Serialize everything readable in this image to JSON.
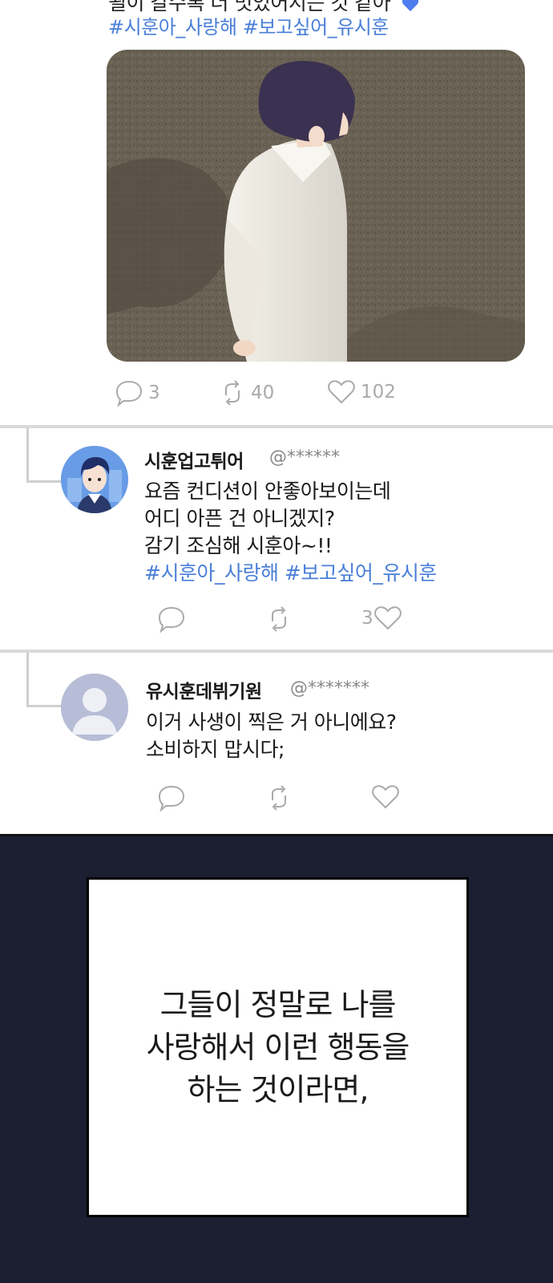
{
  "top_post": {
    "text_partial": "될이 갈수록 더 멋있어지는 것 같아",
    "hashtags": "#시훈아_사랑해 #보고싶어_유시훈",
    "actions": {
      "replies": "3",
      "retweets": "40",
      "likes": "102"
    }
  },
  "replies": [
    {
      "username": "시훈업고튀어",
      "handle": "@******",
      "lines": [
        "요즘 컨디션이 안좋아보이는데",
        "어디 아픈 건 아니겠지?",
        "감기 조심해 시훈아~!!"
      ],
      "hashtags": "#시훈아_사랑해 #보고싶어_유시훈",
      "like_count": "3"
    },
    {
      "username": "유시훈데뷔기원",
      "handle": "@*******",
      "lines": [
        "이거 사생이 찍은 거 아니에요?",
        "소비하지 맙시다;"
      ]
    }
  ],
  "caption": {
    "lines": [
      "그들이 정말로 나를",
      "사랑해서 이런 행동을",
      "하는 것이라면,"
    ]
  },
  "colors": {
    "hashtag": "#4a7fd8",
    "dark_panel": "#1b1f31",
    "divider": "#d9d9d9",
    "icon_gray": "#aaaaaa"
  }
}
